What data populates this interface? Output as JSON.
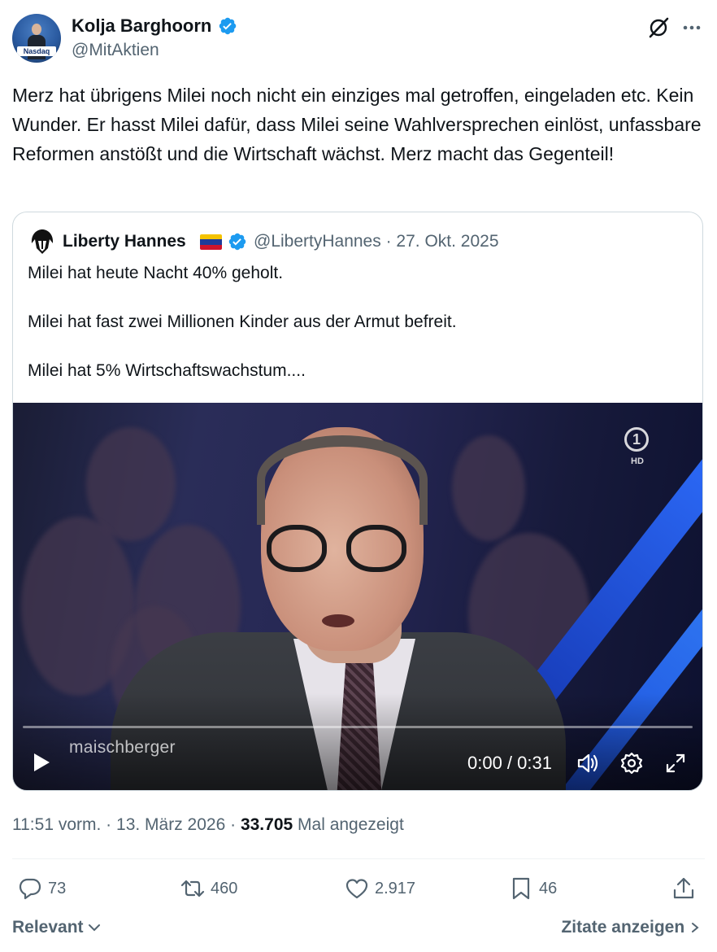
{
  "author": {
    "name": "Kolja Barghoorn",
    "handle": "@MitAktien",
    "avatar_logo_text": "Nasdaq",
    "verified": true
  },
  "header_icons": [
    "grok-icon",
    "more-icon"
  ],
  "tweet": {
    "text": "Merz hat übrigens Milei noch nicht ein einziges mal getroffen, eingeladen etc. Kein Wunder. Er hasst Milei dafür, dass Milei seine Wahlversprechen einlöst, unfassbare Reformen anstößt und die Wirtschaft wächst. Merz macht das Gegenteil!"
  },
  "quoted": {
    "name": "Liberty Hannes",
    "handle": "@LibertyHannes",
    "separator": "·",
    "date": "27. Okt. 2025",
    "lines": [
      "Milei hat heute Nacht 40% geholt.",
      "Milei hat fast zwei Millionen Kinder aus der Armut befreit.",
      "Milei hat 5% Wirtschaftswachstum...."
    ],
    "video": {
      "watermark": "maischberger",
      "channel_logo": "1",
      "channel_hd": "HD",
      "time": "0:00 / 0:31",
      "progress": 0,
      "icons": [
        "play-icon",
        "volume-icon",
        "settings-icon",
        "fullscreen-icon"
      ]
    }
  },
  "meta": {
    "time": "11:51 vorm.",
    "date": "13. März 2026",
    "views_count": "33.705",
    "views_label": "Mal angezeigt",
    "dot": "·"
  },
  "actions": {
    "replies": "73",
    "reposts": "460",
    "likes": "2.917",
    "bookmarks": "46"
  },
  "footer": {
    "relevant": "Relevant",
    "quotes": "Zitate anzeigen"
  },
  "colors": {
    "accent": "#1d9bf0",
    "secondary_text": "#536471",
    "border": "#cfd9de"
  }
}
